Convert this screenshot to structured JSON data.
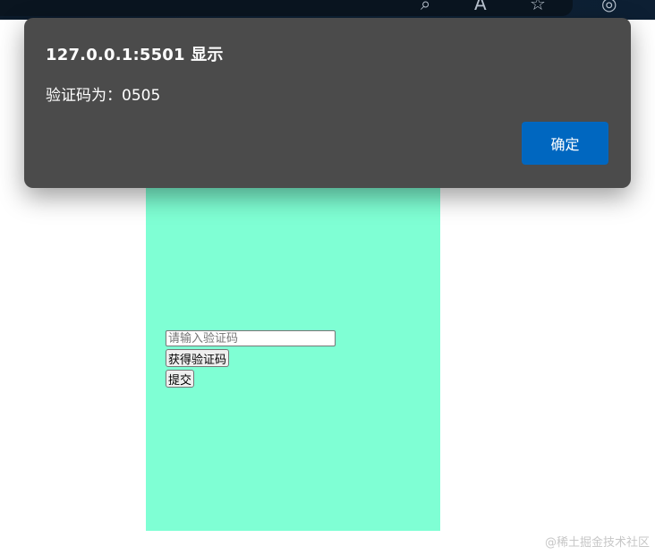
{
  "browser": {
    "icons": [
      "search-icon",
      "read-aloud-icon",
      "favorites-icon",
      "profile-icon"
    ]
  },
  "dialog": {
    "title": "127.0.0.1:5501 显示",
    "message": "验证码为：0505",
    "ok_label": "确定",
    "bg_color": "#4b4b4b",
    "button_color": "#0067c0"
  },
  "form": {
    "code_placeholder": "请输入验证码",
    "get_code_label": "获得验证码",
    "submit_label": "提交",
    "panel_color": "#7fffd4"
  },
  "watermark": "@稀土掘金技术社区"
}
